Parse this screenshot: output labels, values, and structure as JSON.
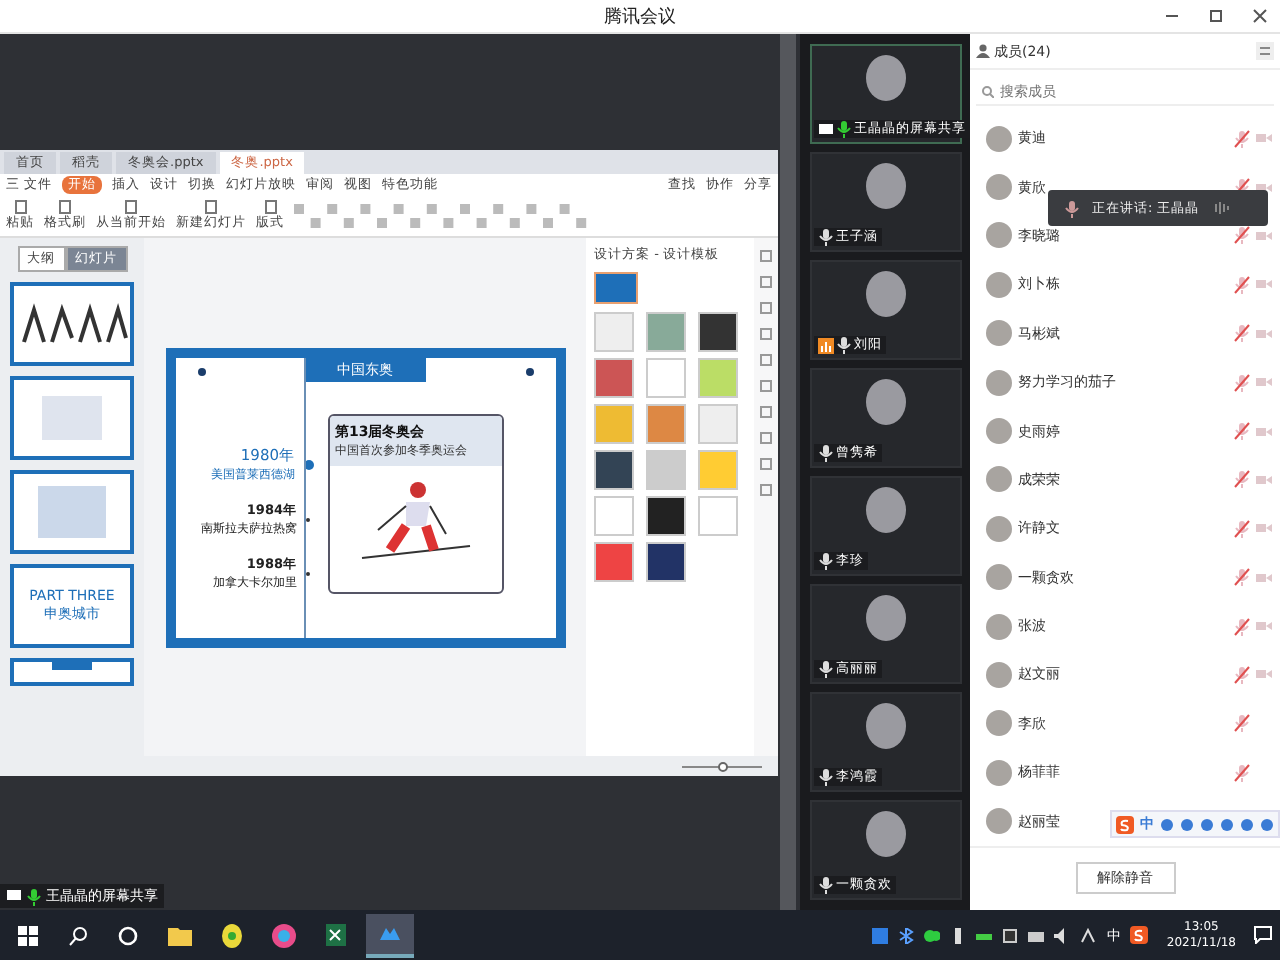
{
  "window": {
    "title": "腾讯会议"
  },
  "shared_screen": {
    "presenter_label": "王晶晶的屏幕共享",
    "app": {
      "tabs": [
        {
          "label": "首页",
          "selected": false
        },
        {
          "label": "稻壳",
          "selected": false
        },
        {
          "label": "冬奥会.pptx",
          "selected": false
        },
        {
          "label": "冬奥.pptx",
          "selected": true
        }
      ],
      "menu": [
        {
          "label": "三 文件",
          "selected": false
        },
        {
          "label": "开始",
          "selected": true
        },
        {
          "label": "插入",
          "selected": false
        },
        {
          "label": "设计",
          "selected": false
        },
        {
          "label": "切换",
          "selected": false
        },
        {
          "label": "幻灯片放映",
          "selected": false
        },
        {
          "label": "审阅",
          "selected": false
        },
        {
          "label": "视图",
          "selected": false
        },
        {
          "label": "特色功能",
          "selected": false
        }
      ],
      "menu_right": [
        "查找",
        "协作",
        "分享"
      ],
      "ribbon": [
        "粘贴",
        "格式刷",
        "从当前开始",
        "新建幻灯片",
        "版式"
      ],
      "panel_tabs": [
        {
          "label": "大纲",
          "selected": false
        },
        {
          "label": "幻灯片",
          "selected": true
        }
      ],
      "thumbnails": [
        {
          "kind": "pictures"
        },
        {
          "kind": "photo"
        },
        {
          "kind": "table"
        },
        {
          "kind": "text",
          "title": "PART THREE",
          "subtitle": "申奥城市"
        },
        {
          "kind": "header"
        }
      ],
      "slide": {
        "title": "中国东奥",
        "card_title": "第13届冬奥会",
        "card_subtitle": "中国首次参加冬季奥运会",
        "timeline": [
          {
            "year": "1980年",
            "place": "美国普莱西德湖",
            "highlight": true
          },
          {
            "year": "1984年",
            "place": "南斯拉夫萨拉热窝",
            "highlight": false
          },
          {
            "year": "1988年",
            "place": "加拿大卡尔加里",
            "highlight": false
          }
        ]
      },
      "design_pane": {
        "title": "设计方案 - 设计模板"
      },
      "zoom": {
        "level": 0.5
      }
    }
  },
  "video_tiles": [
    {
      "name": "王晶晶的屏幕共享",
      "sharing": true,
      "speaking": true,
      "hand_raised": false
    },
    {
      "name": "王子涵",
      "sharing": false,
      "speaking": false,
      "hand_raised": false
    },
    {
      "name": "刘阳",
      "sharing": false,
      "speaking": false,
      "hand_raised": true
    },
    {
      "name": "曾隽希",
      "sharing": false,
      "speaking": false,
      "hand_raised": false
    },
    {
      "name": "李珍",
      "sharing": false,
      "speaking": false,
      "hand_raised": false
    },
    {
      "name": "高丽丽",
      "sharing": false,
      "speaking": false,
      "hand_raised": false
    },
    {
      "name": "李鸿霞",
      "sharing": false,
      "speaking": false,
      "hand_raised": false
    },
    {
      "name": "一颗贪欢",
      "sharing": false,
      "speaking": false,
      "hand_raised": false
    }
  ],
  "members": {
    "title": "成员(24)",
    "search_placeholder": "搜索成员",
    "speaking_toast": "正在讲话: 王晶晶",
    "button": "解除静音",
    "items": [
      {
        "name": "黄迪",
        "camera_off": true
      },
      {
        "name": "黄欣",
        "camera_off": true
      },
      {
        "name": "李晓璐",
        "camera_off": true
      },
      {
        "name": "刘卜栋",
        "camera_off": true
      },
      {
        "name": "马彬斌",
        "camera_off": true
      },
      {
        "name": "努力学习的茄子",
        "camera_off": true
      },
      {
        "name": "史雨婷",
        "camera_off": true
      },
      {
        "name": "成荣荣",
        "camera_off": true
      },
      {
        "name": "许静文",
        "camera_off": true
      },
      {
        "name": "一颗贪欢",
        "camera_off": true
      },
      {
        "name": "张波",
        "camera_off": true
      },
      {
        "name": "赵文丽",
        "camera_off": true
      },
      {
        "name": "李欣",
        "camera_off": false
      },
      {
        "name": "杨菲菲",
        "camera_off": false
      },
      {
        "name": "赵丽莹",
        "camera_off": false
      }
    ]
  },
  "ime_toolbar": {
    "label": "中"
  },
  "taskbar": {
    "input_method": "中",
    "time": "13:05",
    "date": "2021/11/18"
  }
}
